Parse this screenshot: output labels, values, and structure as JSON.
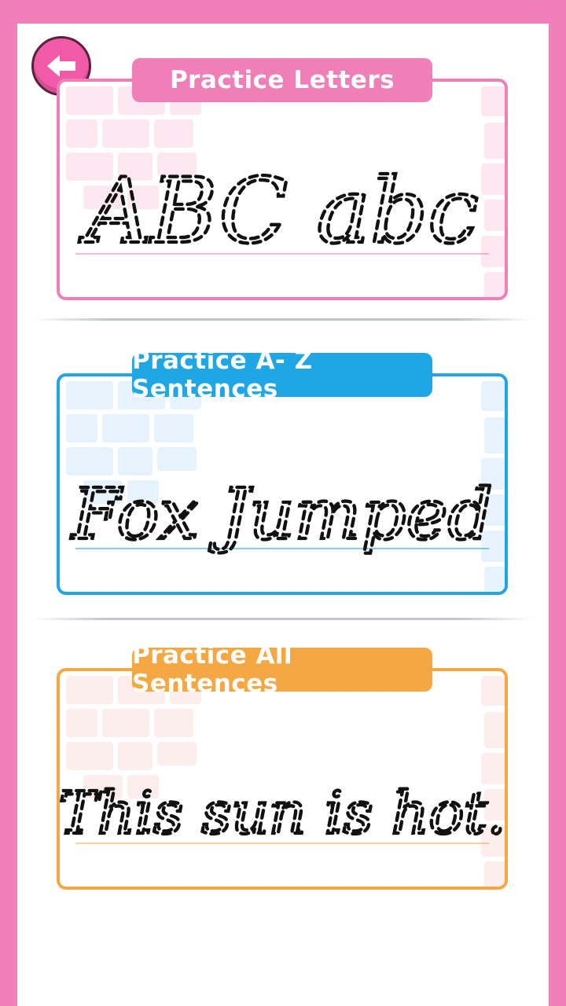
{
  "back": {
    "icon": "arrow-left-icon"
  },
  "cards": [
    {
      "title": "Practice Letters",
      "sample": "ABC abc",
      "color": "#f07fb8",
      "brick_color": "#fde8f1"
    },
    {
      "title": "Practice A- Z Sentences",
      "sample": "Fox Jumped",
      "color": "#1fa6e4",
      "brick_color": "#e6f2fc"
    },
    {
      "title": "Practice All Sentences",
      "sample": "This sun is hot.",
      "color": "#f5a742",
      "brick_color": "#fdeeee"
    }
  ]
}
